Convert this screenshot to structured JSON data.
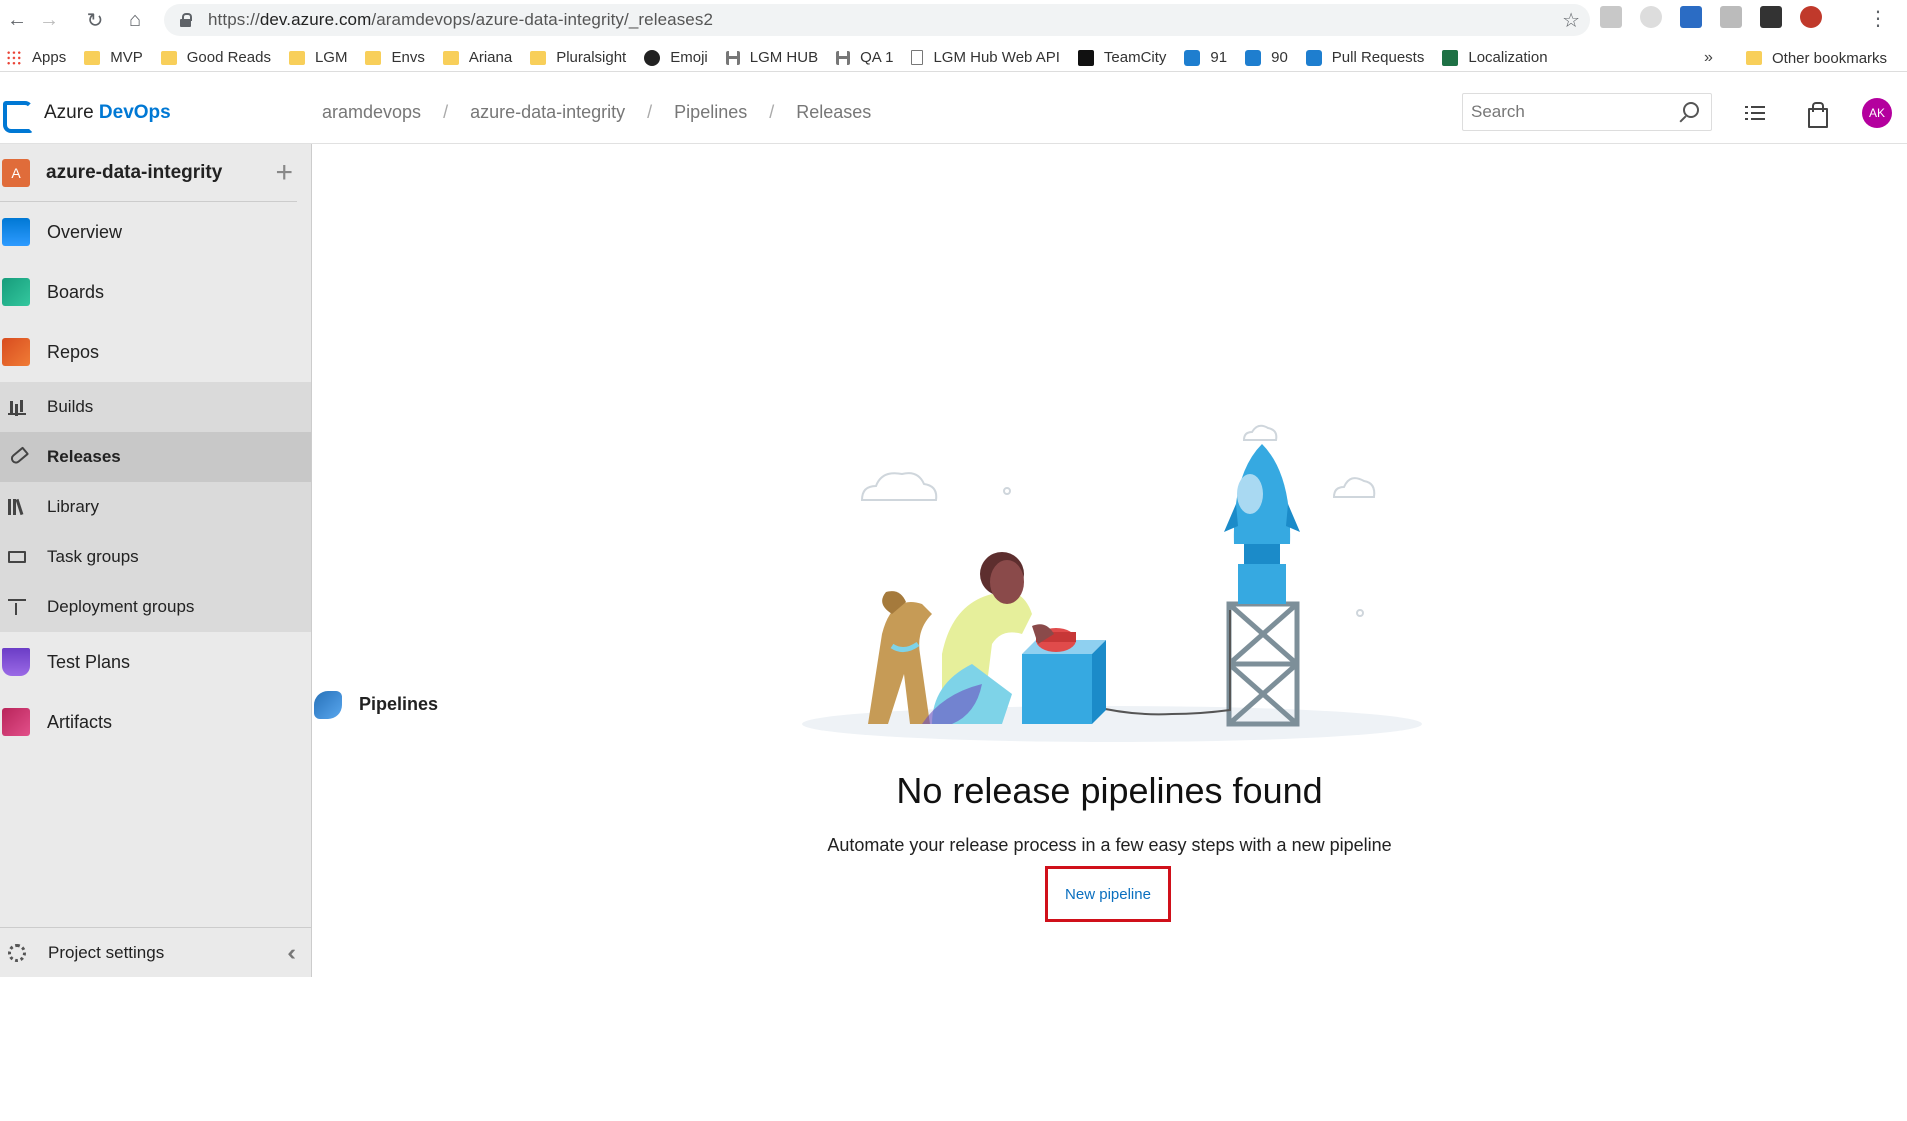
{
  "browser": {
    "url_prefix": "https://",
    "url_host": "dev.azure.com",
    "url_path": "/aramdevops/azure-data-integrity/_releases2",
    "bookmarks": [
      {
        "label": "Apps",
        "icon": "apps-grid-icon"
      },
      {
        "label": "MVP",
        "icon": "folder-icon"
      },
      {
        "label": "Good Reads",
        "icon": "folder-icon"
      },
      {
        "label": "LGM",
        "icon": "folder-icon"
      },
      {
        "label": "Envs",
        "icon": "folder-icon"
      },
      {
        "label": "Ariana",
        "icon": "folder-icon"
      },
      {
        "label": "Pluralsight",
        "icon": "folder-icon"
      },
      {
        "label": "Emoji",
        "icon": "github-icon"
      },
      {
        "label": "LGM HUB",
        "icon": "hublink-icon"
      },
      {
        "label": "QA 1",
        "icon": "hublink-icon"
      },
      {
        "label": "LGM Hub Web API",
        "icon": "page-icon"
      },
      {
        "label": "TeamCity",
        "icon": "teamcity-icon"
      },
      {
        "label": "91",
        "icon": "azure-icon"
      },
      {
        "label": "90",
        "icon": "azure-icon"
      },
      {
        "label": "Pull Requests",
        "icon": "azure-icon"
      },
      {
        "label": "Localization",
        "icon": "excel-icon"
      }
    ],
    "more": "»",
    "other_bookmarks": "Other bookmarks"
  },
  "header": {
    "logo_part1": "Azure",
    "logo_part2": "DevOps",
    "breadcrumb": [
      "aramdevops",
      "azure-data-integrity",
      "Pipelines",
      "Releases"
    ],
    "search_placeholder": "Search",
    "avatar_initials": "AK"
  },
  "sidebar": {
    "project_initial": "A",
    "project_name": "azure-data-integrity",
    "items": [
      {
        "label": "Overview"
      },
      {
        "label": "Boards"
      },
      {
        "label": "Repos"
      },
      {
        "label": "Pipelines"
      },
      {
        "label": "Test Plans"
      },
      {
        "label": "Artifacts"
      }
    ],
    "pipeline_subitems": [
      {
        "label": "Builds"
      },
      {
        "label": "Releases"
      },
      {
        "label": "Library"
      },
      {
        "label": "Task groups"
      },
      {
        "label": "Deployment groups"
      }
    ],
    "settings_label": "Project settings"
  },
  "main": {
    "empty_title": "No release pipelines found",
    "empty_subtitle": "Automate your release process in a few easy steps with a new pipeline",
    "new_pipeline_label": "New pipeline"
  },
  "colors": {
    "accent": "#0078d4",
    "highlight_border": "#d0101a",
    "avatar": "#b4009e",
    "project_badge": "#e06c3a"
  }
}
